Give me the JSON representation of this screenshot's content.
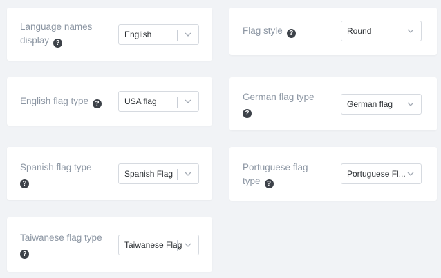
{
  "settings": [
    {
      "label": "Language names display",
      "selected": "English"
    },
    {
      "label": "Flag style",
      "selected": "Round"
    },
    {
      "label": "English flag type",
      "selected": "USA flag"
    },
    {
      "label": "German flag type",
      "selected": "German flag"
    },
    {
      "label": "Spanish flag type",
      "selected": "Spanish Flag"
    },
    {
      "label": "Portuguese flag type",
      "selected": "Portuguese Fl..."
    },
    {
      "label": "Taiwanese flag type",
      "selected": "Taiwanese Flag"
    }
  ],
  "help_icon_glyph": "?",
  "icons": {
    "help": "question-circle-icon",
    "dropdown": "chevron-down-icon"
  }
}
